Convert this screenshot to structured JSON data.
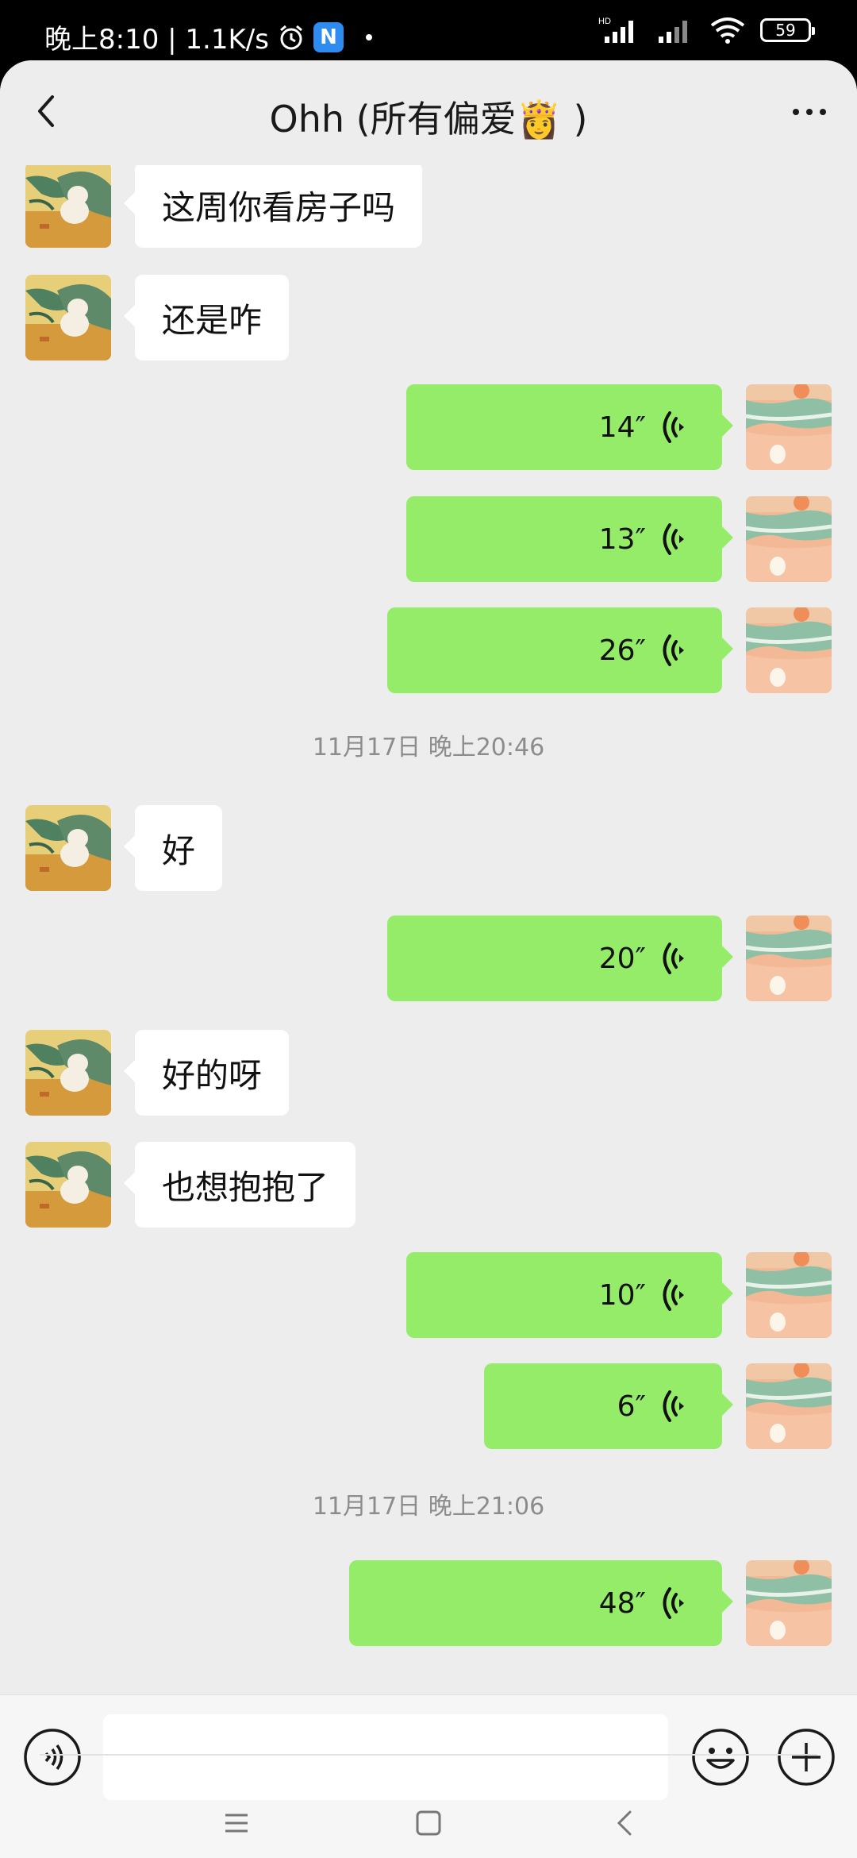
{
  "status_bar": {
    "time_text": "晚上8:10 | 1.1K/s",
    "app_badge": "N",
    "network_badge": "HD",
    "battery": "59"
  },
  "header": {
    "title": "Ohh (所有偏爱👸 )"
  },
  "messages": [
    {
      "side": "in",
      "type": "text",
      "text": "这周你看房子吗"
    },
    {
      "side": "in",
      "type": "text",
      "text": "还是咋"
    },
    {
      "side": "out",
      "type": "voice",
      "duration": "14″"
    },
    {
      "side": "out",
      "type": "voice",
      "duration": "13″"
    },
    {
      "side": "out",
      "type": "voice",
      "duration": "26″"
    },
    {
      "type": "timestamp",
      "text": "11月17日 晚上20:46"
    },
    {
      "side": "in",
      "type": "text",
      "text": "好"
    },
    {
      "side": "out",
      "type": "voice",
      "duration": "20″"
    },
    {
      "side": "in",
      "type": "text",
      "text": "好的呀"
    },
    {
      "side": "in",
      "type": "text",
      "text": "也想抱抱了"
    },
    {
      "side": "out",
      "type": "voice",
      "duration": "10″"
    },
    {
      "side": "out",
      "type": "voice",
      "duration": "6″"
    },
    {
      "type": "timestamp",
      "text": "11月17日 晚上21:06"
    },
    {
      "side": "out",
      "type": "voice",
      "duration": "48″"
    }
  ],
  "input_bar": {
    "voice_icon": "voice-mode-icon",
    "emoji_icon": "emoji-icon",
    "plus_icon": "plus-icon",
    "text_value": ""
  },
  "nav_bar": {
    "icons": [
      "menu-icon",
      "home-icon",
      "back-icon"
    ]
  },
  "colors": {
    "chat_background": "#ededed",
    "outgoing_bubble": "#95ec69",
    "incoming_bubble": "#ffffff"
  }
}
